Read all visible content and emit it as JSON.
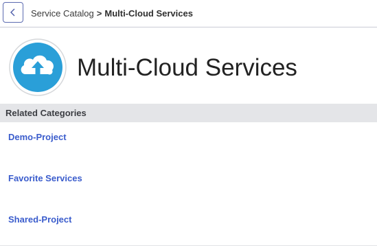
{
  "nav": {
    "back_icon": "chevron-left-icon",
    "breadcrumb": {
      "parent": "Service Catalog",
      "separator": ">",
      "current": "Multi-Cloud Services"
    }
  },
  "header": {
    "logo_icon": "cloud-upload-icon",
    "title": "Multi-Cloud Services"
  },
  "related": {
    "heading": "Related Categories",
    "items": [
      {
        "label": "Demo-Project"
      },
      {
        "label": "Favorite Services"
      },
      {
        "label": "Shared-Project"
      }
    ]
  },
  "colors": {
    "link": "#3a5ccc",
    "logo_blue": "#2a9fd8",
    "section_bg": "#e4e5e8"
  }
}
